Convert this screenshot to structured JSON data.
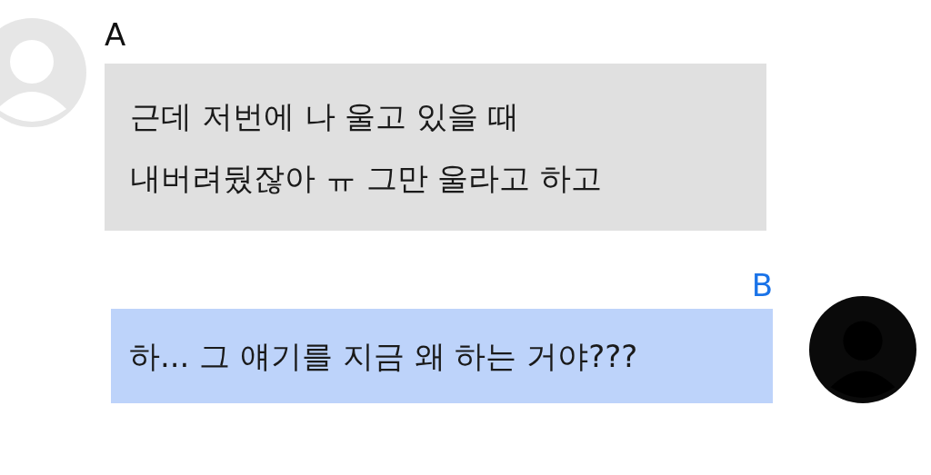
{
  "messages": [
    {
      "kind": "incoming",
      "sender": "A",
      "text": "근데 저번에 나 울고 있을 때\n내버려뒀잖아 ㅠ 그만 울라고 하고"
    },
    {
      "kind": "outgoing",
      "sender": "B",
      "text": "하... 그 얘기를 지금 왜 하는 거야???"
    }
  ]
}
